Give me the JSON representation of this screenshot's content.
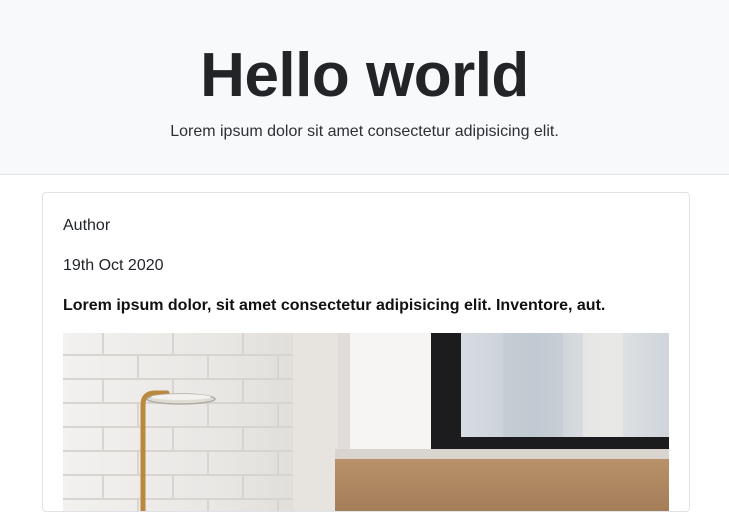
{
  "hero": {
    "title": "Hello world",
    "subtitle": "Lorem ipsum dolor sit amet consectetur adipisicing elit."
  },
  "post": {
    "author": "Author",
    "date": "19th Oct 2020",
    "title": "Lorem ipsum dolor, sit amet consectetur adipisicing elit. Inventore, aut.",
    "image_icon": "room-photo-icon"
  },
  "colors": {
    "hero_background": "#f8f9fa",
    "text_dark": "#222428",
    "card_border": "#dfe2e6"
  }
}
